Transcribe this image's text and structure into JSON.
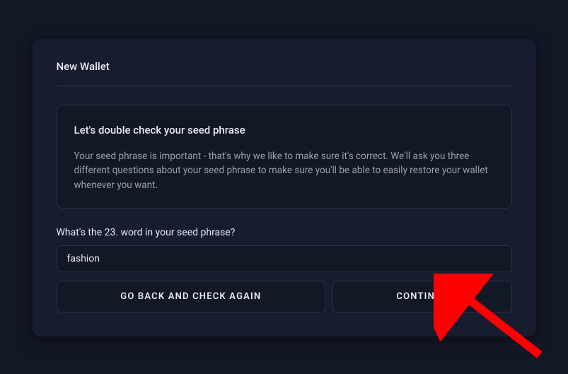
{
  "card": {
    "title": "New Wallet"
  },
  "info": {
    "heading": "Let's double check your seed phrase",
    "text": "Your seed phrase is important - that's why we like to make sure it's correct. We'll ask you three different questions about your seed phrase to make sure you'll be able to easily restore your wallet whenever you want."
  },
  "question": {
    "label": "What's the 23. word in your seed phrase?",
    "value": "fashion"
  },
  "buttons": {
    "back": "GO BACK AND CHECK AGAIN",
    "continue": "CONTINUE"
  }
}
